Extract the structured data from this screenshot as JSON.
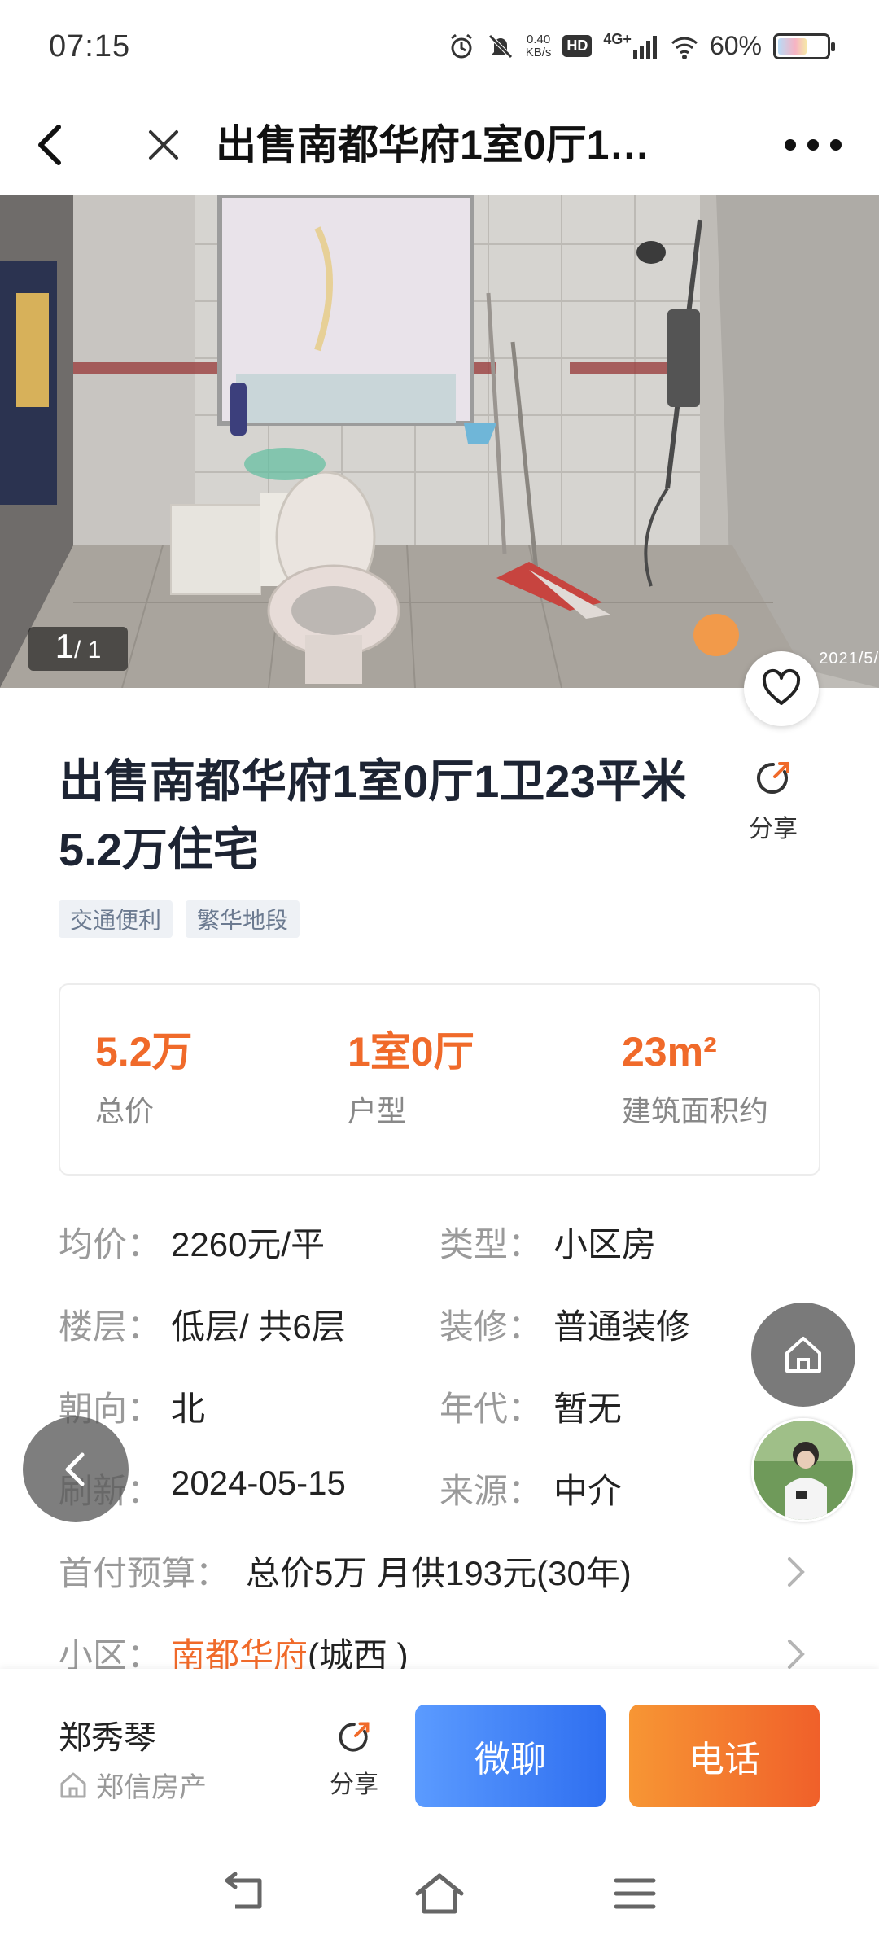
{
  "status_bar": {
    "time": "07:15",
    "net_speed_value": "0.40",
    "net_speed_unit": "KB/s",
    "hd": "HD",
    "network": "4G+",
    "battery": "60%",
    "battery_level": 0.6
  },
  "title_bar": {
    "title": "出售南都华府1室0厅1…"
  },
  "photo": {
    "counter_current": "1",
    "counter_total": "/ 1",
    "date_stamp": "2021/5/"
  },
  "listing": {
    "headline": "出售南都华府1室0厅1卫23平米5.2万住宅",
    "share_label": "分享",
    "tags": [
      "交通便利",
      "繁华地段"
    ]
  },
  "summary": {
    "price_value": "5.2万",
    "price_label": "总价",
    "layout_value": "1室0厅",
    "layout_label": "户型",
    "area_value": "23m²",
    "area_label": "建筑面积约"
  },
  "details": {
    "unit_price_key": "均价：",
    "unit_price_val": "2260元/平",
    "type_key": "类型：",
    "type_val": "小区房",
    "floor_key": "楼层：",
    "floor_val": "低层/ 共6层",
    "decor_key": "装修：",
    "decor_val": "普通装修",
    "orient_key": "朝向：",
    "orient_val": "北",
    "year_key": "年代：",
    "year_val": "暂无",
    "refresh_key": "刷新：",
    "refresh_val": "2024-05-15",
    "source_key": "来源：",
    "source_val": "中介",
    "down_payment_key": "首付预算：",
    "down_payment_val": "总价5万 月供193元(30年)",
    "community_key": "小区：",
    "community_name": "南都华府",
    "community_area": "(城西 )"
  },
  "bottom_bar": {
    "agent_name": "郑秀琴",
    "agent_company": "郑信房产",
    "share_label": "分享",
    "chat_label": "微聊",
    "call_label": "电话"
  },
  "colors": {
    "accent_orange": "#f06a2a",
    "chat_blue": "#2f6ff0",
    "text_dark": "#1d2433",
    "text_gray": "#9a9a9a"
  },
  "icons": [
    "back-arrow-icon",
    "close-icon",
    "more-icon",
    "heart-icon",
    "share-icon",
    "home-icon",
    "chevron-left-icon",
    "chevron-right-icon",
    "store-icon",
    "nav-back-icon",
    "nav-home-icon",
    "nav-menu-icon"
  ]
}
